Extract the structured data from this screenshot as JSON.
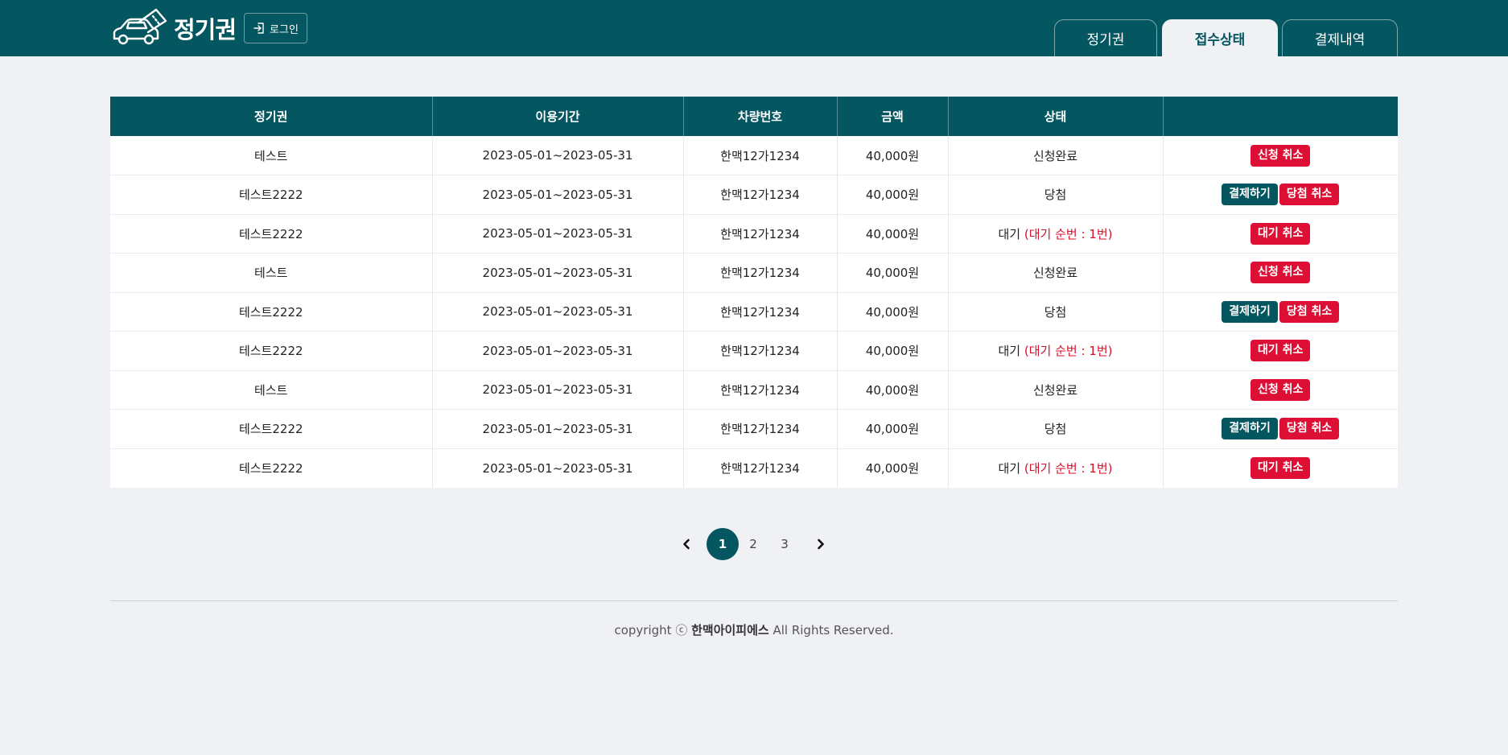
{
  "header": {
    "brand": "정기권",
    "login_label": "로그인",
    "tabs": [
      {
        "label": "정기권",
        "active": false
      },
      {
        "label": "접수상태",
        "active": true
      },
      {
        "label": "결제내역",
        "active": false
      }
    ]
  },
  "table": {
    "columns": [
      "정기권",
      "이용기간",
      "차량번호",
      "금액",
      "상태",
      ""
    ],
    "rows": [
      {
        "pass": "테스트",
        "period": "2023-05-01~2023-05-31",
        "plate": "한맥12가1234",
        "amount": "40,000원",
        "status": "신청완료",
        "status_extra": "",
        "actions": [
          {
            "label": "신청 취소",
            "color": "red"
          }
        ]
      },
      {
        "pass": "테스트2222",
        "period": "2023-05-01~2023-05-31",
        "plate": "한맥12가1234",
        "amount": "40,000원",
        "status": "당첨",
        "status_extra": "",
        "actions": [
          {
            "label": "결제하기",
            "color": "teal"
          },
          {
            "label": "당첨 취소",
            "color": "red"
          }
        ]
      },
      {
        "pass": "테스트2222",
        "period": "2023-05-01~2023-05-31",
        "plate": "한맥12가1234",
        "amount": "40,000원",
        "status": "대기",
        "status_extra": "(대기 순번 : 1번)",
        "actions": [
          {
            "label": "대기 취소",
            "color": "red"
          }
        ]
      },
      {
        "pass": "테스트",
        "period": "2023-05-01~2023-05-31",
        "plate": "한맥12가1234",
        "amount": "40,000원",
        "status": "신청완료",
        "status_extra": "",
        "actions": [
          {
            "label": "신청 취소",
            "color": "red"
          }
        ]
      },
      {
        "pass": "테스트2222",
        "period": "2023-05-01~2023-05-31",
        "plate": "한맥12가1234",
        "amount": "40,000원",
        "status": "당첨",
        "status_extra": "",
        "actions": [
          {
            "label": "결제하기",
            "color": "teal"
          },
          {
            "label": "당첨 취소",
            "color": "red"
          }
        ]
      },
      {
        "pass": "테스트2222",
        "period": "2023-05-01~2023-05-31",
        "plate": "한맥12가1234",
        "amount": "40,000원",
        "status": "대기",
        "status_extra": "(대기 순번 : 1번)",
        "actions": [
          {
            "label": "대기 취소",
            "color": "red"
          }
        ]
      },
      {
        "pass": "테스트",
        "period": "2023-05-01~2023-05-31",
        "plate": "한맥12가1234",
        "amount": "40,000원",
        "status": "신청완료",
        "status_extra": "",
        "actions": [
          {
            "label": "신청 취소",
            "color": "red"
          }
        ]
      },
      {
        "pass": "테스트2222",
        "period": "2023-05-01~2023-05-31",
        "plate": "한맥12가1234",
        "amount": "40,000원",
        "status": "당첨",
        "status_extra": "",
        "actions": [
          {
            "label": "결제하기",
            "color": "teal"
          },
          {
            "label": "당첨 취소",
            "color": "red"
          }
        ]
      },
      {
        "pass": "테스트2222",
        "period": "2023-05-01~2023-05-31",
        "plate": "한맥12가1234",
        "amount": "40,000원",
        "status": "대기",
        "status_extra": "(대기 순번 : 1번)",
        "actions": [
          {
            "label": "대기 취소",
            "color": "red"
          }
        ]
      }
    ]
  },
  "pagination": {
    "pages": [
      "1",
      "2",
      "3"
    ],
    "current": "1",
    "prev_icon": "chevron-left-icon",
    "next_icon": "chevron-right-icon"
  },
  "footer": {
    "prefix": "copyright ⓒ ",
    "company": "한맥아이피에스",
    "suffix": " All Rights Reserved."
  },
  "colors": {
    "primary": "#045660",
    "danger": "#dd0f35",
    "background": "#eff1f5"
  }
}
